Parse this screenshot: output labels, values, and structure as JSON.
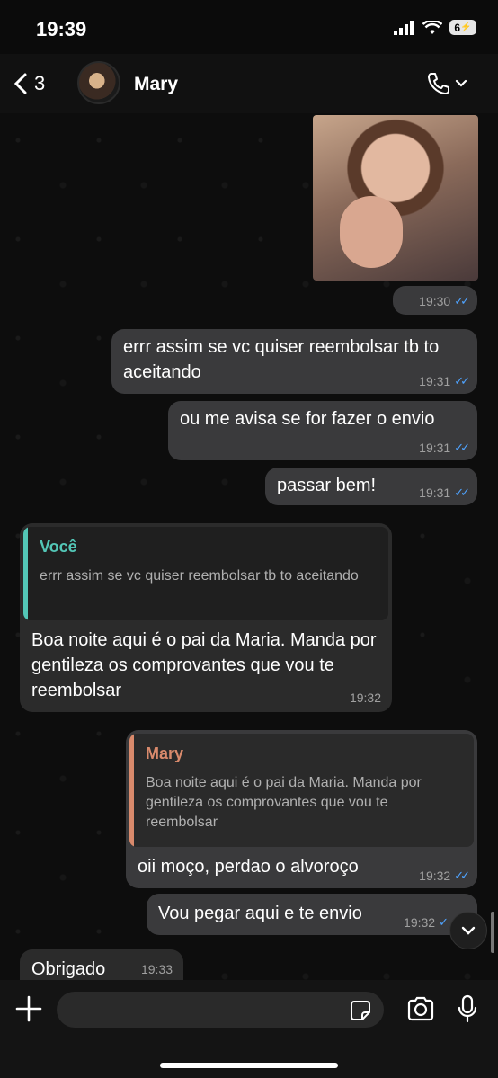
{
  "status_bar": {
    "time": "19:39",
    "battery": "6"
  },
  "header": {
    "back_count": "3",
    "contact_name": "Mary"
  },
  "messages": [
    {
      "type": "image",
      "time": "19:30",
      "read": true
    },
    {
      "type": "out",
      "text": "errr assim se vc quiser reembolsar tb to aceitando",
      "time": "19:31",
      "read": true
    },
    {
      "type": "out",
      "text": "ou me avisa se for fazer o envio",
      "time": "19:31",
      "read": true
    },
    {
      "type": "out",
      "text": "passar bem!",
      "time": "19:31",
      "read": true
    },
    {
      "type": "in",
      "quote_name": "Você",
      "quote_text": "errr assim se vc quiser reembolsar tb to aceitando",
      "text": "Boa noite aqui é o pai da Maria. Manda por gentileza os comprovantes que vou te reembolsar",
      "time": "19:32"
    },
    {
      "type": "out",
      "quote_name": "Mary",
      "quote_text": "Boa noite aqui é o pai da Maria. Manda por gentileza os comprovantes que vou te reembolsar",
      "text": "oii moço, perdao o alvoroço",
      "time": "19:32",
      "read": true
    },
    {
      "type": "out",
      "text": "Vou pegar aqui e te envio",
      "time": "19:32",
      "read": true
    },
    {
      "type": "in",
      "text": "Obrigado",
      "time": "19:33"
    }
  ],
  "colors": {
    "quote_you": "#53c6b6",
    "quote_mary": "#d98a6c",
    "read_ticks": "#4fa3ff"
  },
  "icons": [
    "back-chevron-icon",
    "phone-icon",
    "chevron-down-icon",
    "plus-icon",
    "sticker-icon",
    "camera-icon",
    "microphone-icon",
    "scroll-down-icon"
  ]
}
